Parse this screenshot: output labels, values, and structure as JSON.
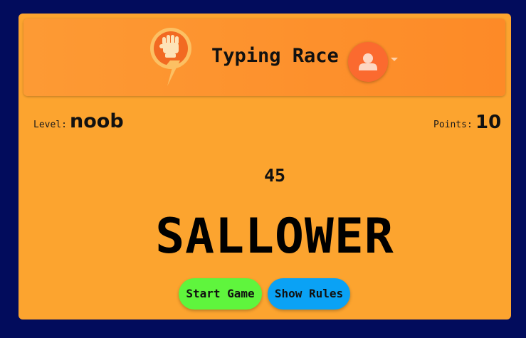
{
  "app": {
    "title": "Typing Race"
  },
  "header": {
    "logo_icon": "lightning-fist-icon",
    "avatar_icon": "user-avatar-icon",
    "dropdown_icon": "caret-down-icon"
  },
  "stats": {
    "level_label": "Level:",
    "level_value": "noob",
    "points_label": "Points:",
    "points_value": "10"
  },
  "game": {
    "timer": "45",
    "current_word": "SALLOWER"
  },
  "buttons": {
    "start_label": "Start Game",
    "rules_label": "Show Rules"
  },
  "colors": {
    "background": "#020c5c",
    "panel": "#fca42f",
    "header": "#fd8f2b",
    "avatar": "#fb6a2f",
    "start_button": "#5ff53d",
    "rules_button": "#0aa2f5"
  }
}
